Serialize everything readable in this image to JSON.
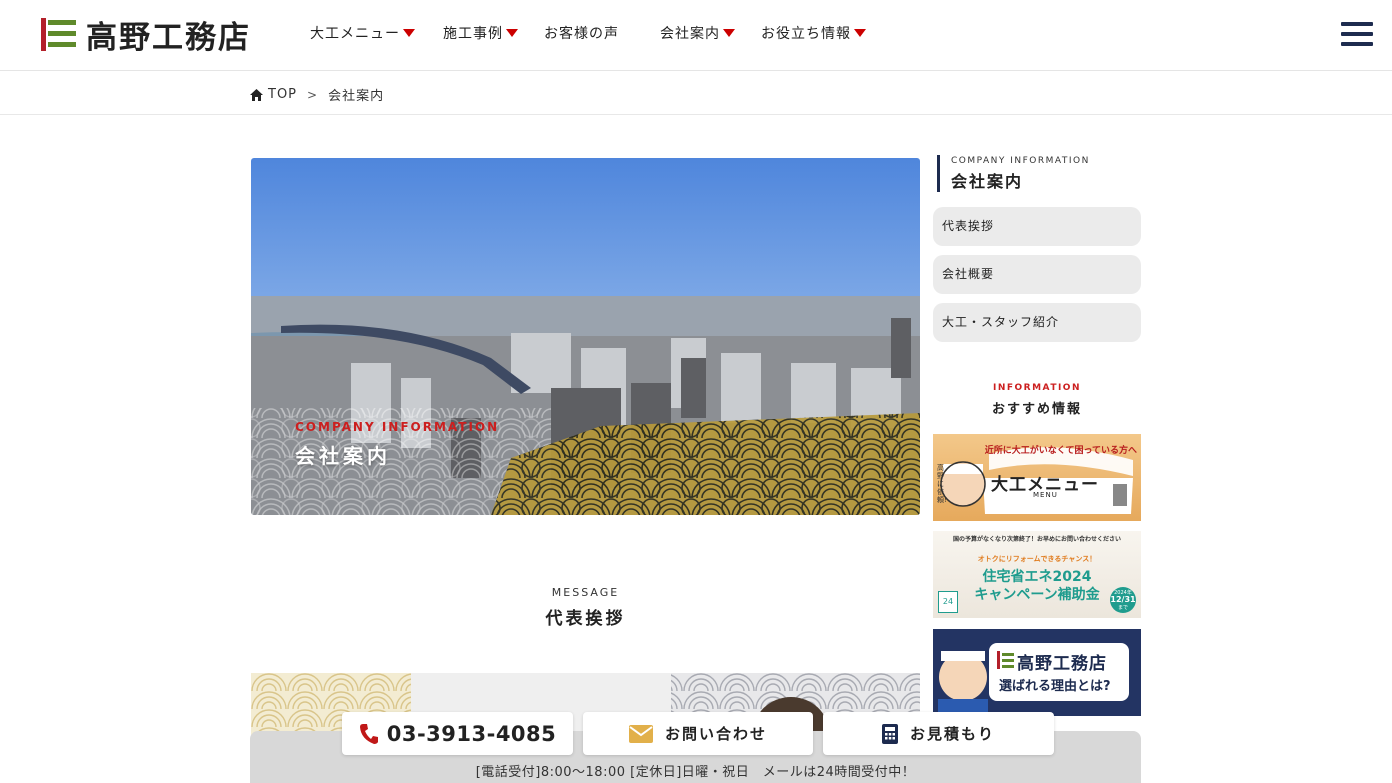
{
  "header": {
    "logo_text": "高野工務店",
    "nav": [
      {
        "label": "大工メニュー",
        "has_dropdown": true
      },
      {
        "label": "施工事例",
        "has_dropdown": true
      },
      {
        "label": "お客様の声",
        "has_dropdown": false
      },
      {
        "label": "会社案内",
        "has_dropdown": true
      },
      {
        "label": "お役立ち情報",
        "has_dropdown": true
      }
    ],
    "menu_icon": "hamburger-icon"
  },
  "breadcrumb": {
    "home": "TOP",
    "separator": ">",
    "current": "会社案内"
  },
  "hero": {
    "subtitle": "COMPANY INFORMATION",
    "title": "会社案内"
  },
  "message_section": {
    "subtitle": "MESSAGE",
    "title": "代表挨拶"
  },
  "sidebar": {
    "subtitle": "COMPANY INFORMATION",
    "title": "会社案内",
    "links": [
      "代表挨拶",
      "会社概要",
      "大工・スタッフ紹介"
    ],
    "info_subtitle": "INFORMATION",
    "info_title": "おすすめ情報",
    "banners": [
      {
        "top_text": "近所に大工がいなくて困っている方へ",
        "main_text": "大工メニュー",
        "sub_text": "MENU",
        "side_text": "高野に依頼!"
      },
      {
        "top_text": "国の予算がなくなり次第終了！お早めにお問い合わせください",
        "accent_text": "オトクにリフォームできるチャンス！",
        "main_text": "住宅省エネ2024",
        "main_text2": "キャンペーン補助金",
        "badge_year": "2024年",
        "badge_date": "12/31",
        "badge_suffix": "まで"
      },
      {
        "main_text": "高野工務店",
        "sub_text": "選ばれる理由とは?"
      }
    ]
  },
  "footer": {
    "phone": "03-3913-4085",
    "contact_label": "お問い合わせ",
    "estimate_label": "お見積もり",
    "note": "[電話受付]8:00〜18:00 [定休日]日曜・祝日　メールは24時間受付中！"
  },
  "colors": {
    "accent_red": "#cc0000",
    "navy": "#1d2b4f",
    "logo_green": "#5f8a2b",
    "logo_red": "#b3202a"
  }
}
